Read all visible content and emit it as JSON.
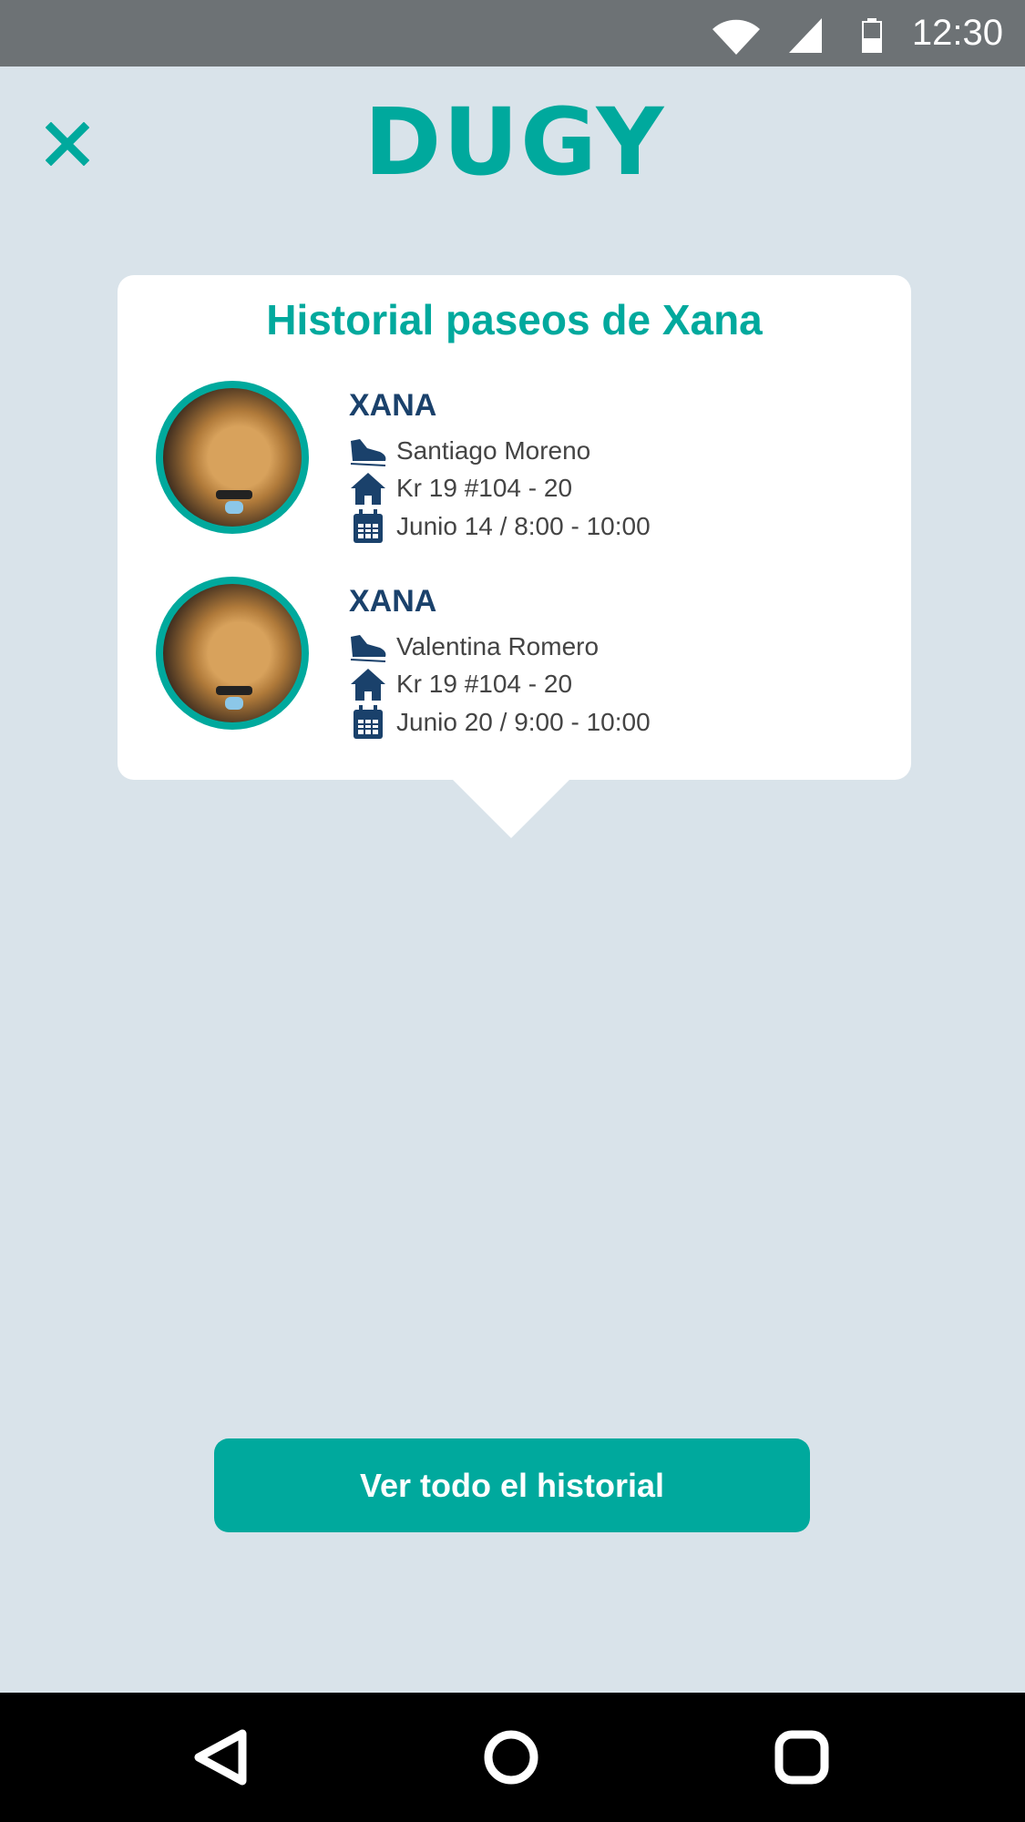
{
  "status_bar": {
    "time": "12:30",
    "icons": [
      "wifi-icon",
      "signal-icon",
      "battery-icon"
    ]
  },
  "header": {
    "logo": "DUGY",
    "close_icon": "close-icon"
  },
  "card": {
    "title": "Historial paseos de Xana",
    "items": [
      {
        "name": "XANA",
        "walker": "Santiago Moreno",
        "address": "Kr 19 #104 - 20",
        "schedule": "Junio 14 / 8:00 - 10:00"
      },
      {
        "name": "XANA",
        "walker": "Valentina Romero",
        "address": "Kr 19 #104 - 20",
        "schedule": "Junio 20 / 9:00 - 10:00"
      }
    ]
  },
  "button": {
    "label": "Ver todo el historial"
  },
  "colors": {
    "accent": "#00a99d",
    "navy": "#1a416b",
    "background": "#d9e3ea"
  }
}
